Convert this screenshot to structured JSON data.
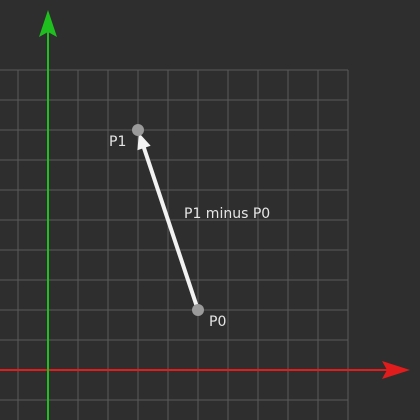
{
  "viewport": {
    "background_color": "#2e2e2e",
    "grid_color": "#5a5a5a",
    "x_axis_color": "#e01c1c",
    "y_axis_color": "#1fbf1f",
    "vector_color": "#f2f2f2",
    "point_color": "#9a9a9a",
    "label_color": "#e6e6e6"
  },
  "grid": {
    "x_min": -1,
    "x_max": 10,
    "y_min": -1,
    "y_max": 10
  },
  "points": {
    "p0": {
      "label": "P0",
      "x": 5,
      "y": 2
    },
    "p1": {
      "label": "P1",
      "x": 3,
      "y": 8
    }
  },
  "vector": {
    "label": "P1 minus P0",
    "from": "p0",
    "to": "p1"
  }
}
